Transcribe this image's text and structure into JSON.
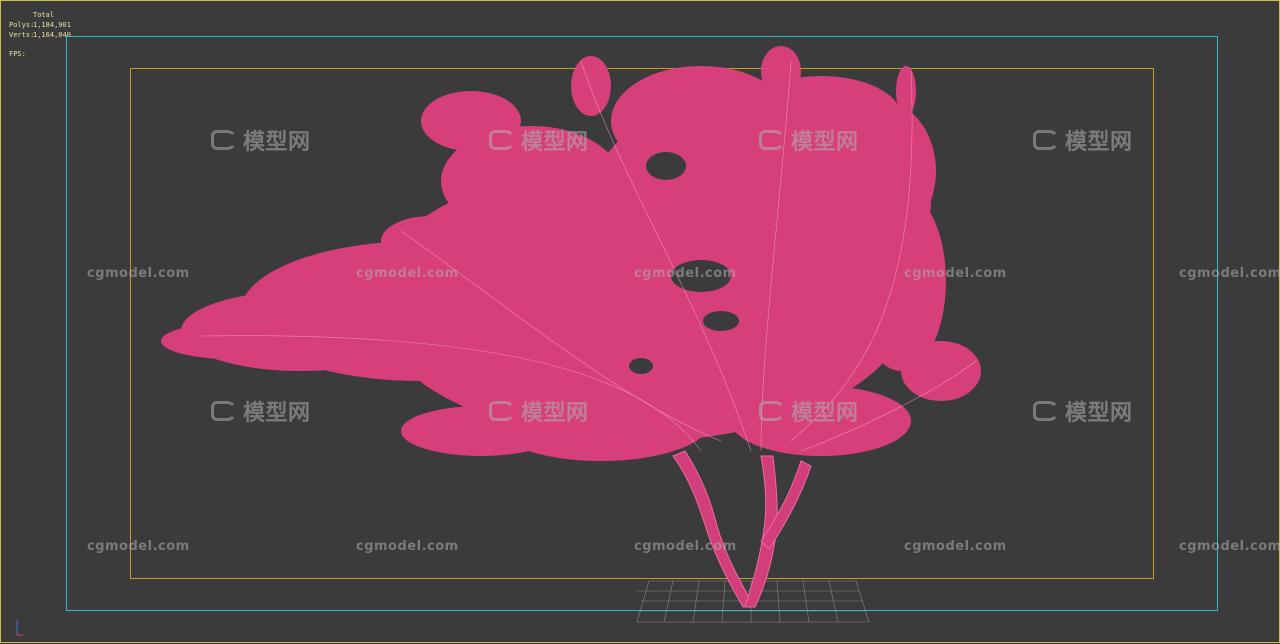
{
  "viewport": {
    "stats": {
      "header": "Total",
      "polys_label": "Polys:",
      "polys_value": "1,184,901",
      "verts_label": "Verts:",
      "verts_value": "1,164,040",
      "fps_label": "FPS:"
    },
    "colors": {
      "background": "#3b3b3b",
      "safe_action_frame": "#2fb9c5",
      "safe_title_frame": "#c79b2a",
      "tree_wireframe": "#e0407f",
      "grid": "#9a9a9a"
    }
  },
  "watermarks": {
    "site_text": "cgmodel.com",
    "logo_text": "模型网",
    "logo_icon": "cg-logo-icon"
  }
}
